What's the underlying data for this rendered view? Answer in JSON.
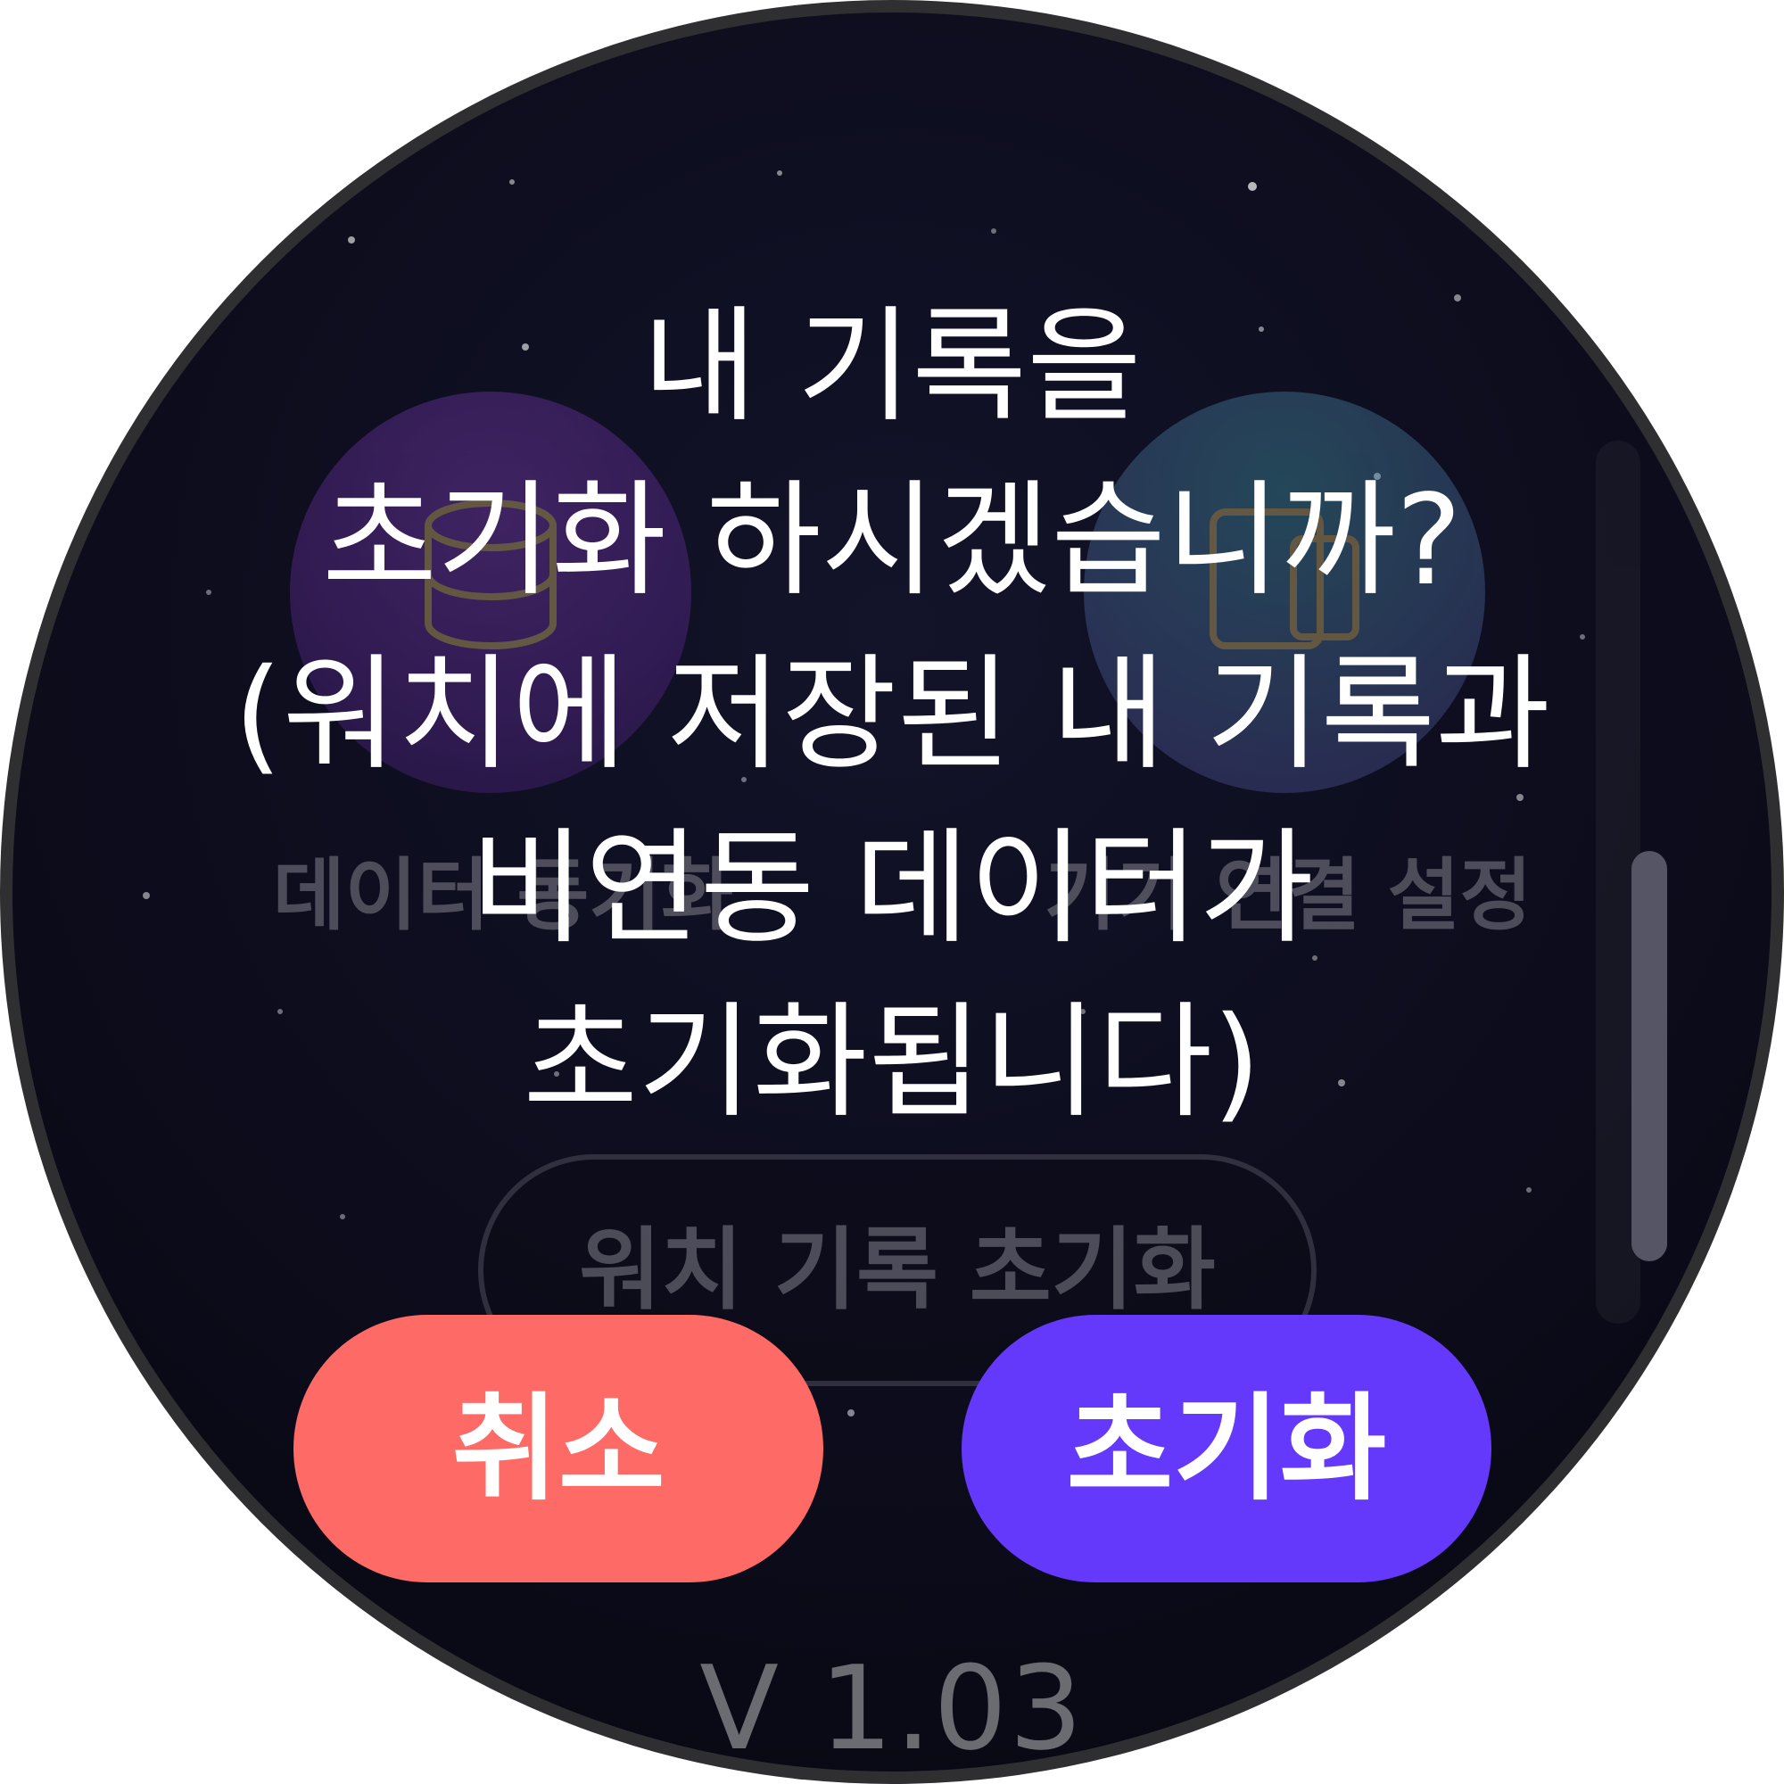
{
  "background": {
    "left_option_label": "데이터 동기화",
    "right_option_label": "기기 연결 설정",
    "reset_button_label": "워치 기록 초기화",
    "left_option_icon": "database-icon",
    "right_option_icon": "devices-icon"
  },
  "dialog": {
    "message_lines": [
      "내 기록을",
      "초기화 하시겠습니까?",
      "(워치에 저장된 내 기록과",
      "비연동 데이터가",
      "초기화됩니다)"
    ],
    "cancel_label": "취소",
    "confirm_label": "초기화"
  },
  "version": "V 1.03",
  "colors": {
    "cancel": "#fe6a66",
    "confirm": "#6539fc",
    "background": "#0c0c1c"
  }
}
